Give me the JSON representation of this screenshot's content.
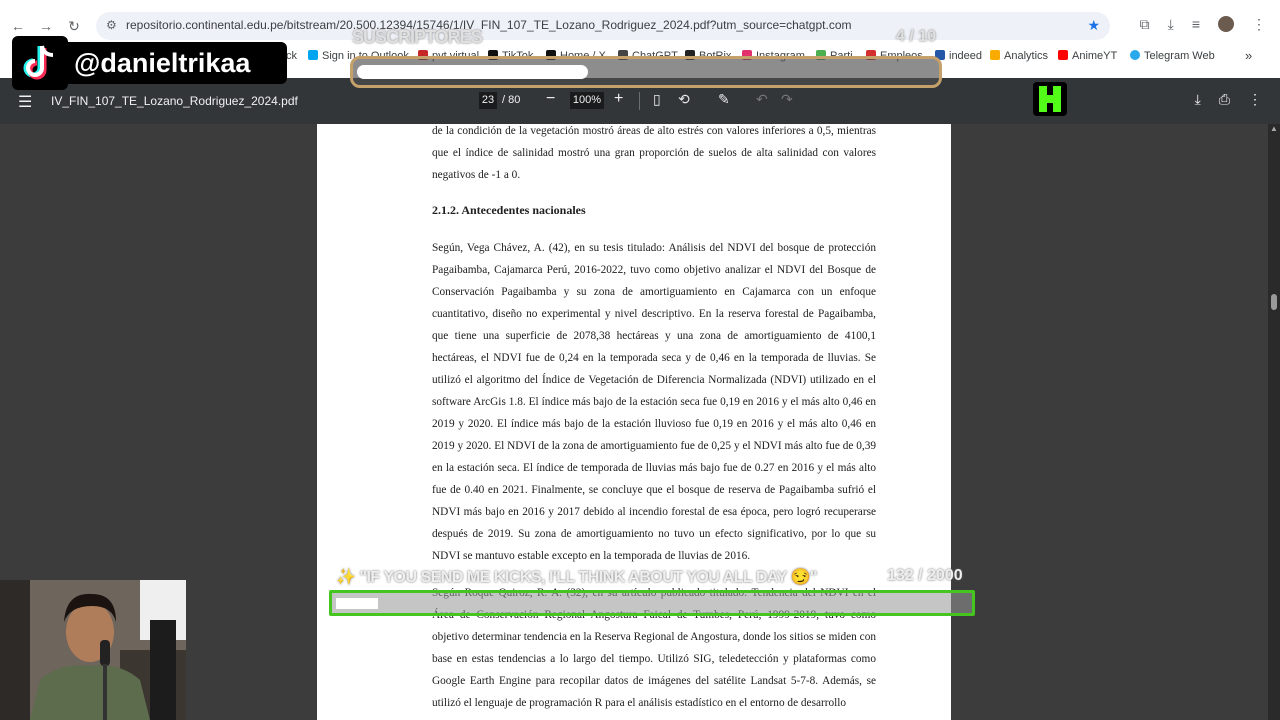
{
  "browser": {
    "url": "repositorio.continental.edu.pe/bitstream/20.500.12394/15746/1/IV_FIN_107_TE_Lozano_Rodriguez_2024.pdf?utm_source=chatgpt.com",
    "bookmarks": [
      "ck",
      "Sign in to Outlook",
      "pvt virtual",
      "TikTok",
      "Home / X",
      "ChatGPT",
      "BotRix",
      "Instagram",
      "Parti",
      "Empleos",
      "indeed",
      "Analytics",
      "AnimeYT",
      "Telegram Web"
    ]
  },
  "pdf": {
    "filename": "IV_FIN_107_TE_Lozano_Rodriguez_2024.pdf",
    "page_current": "23",
    "page_total": "/ 80",
    "zoom": "100%",
    "paragraph_intro": "de la condición de la vegetación mostró áreas de alto estrés con valores inferiores a 0,5, mientras que el índice de salinidad mostró una gran proporción de suelos de alta salinidad con valores negativos de -1 a 0.",
    "heading": "2.1.2.  Antecedentes nacionales",
    "paragraph_1": "Según, Vega Chávez, A. (42), en su tesis titulado: Análisis del NDVI del bosque de protección Pagaibamba, Cajamarca Perú, 2016-2022, tuvo como objetivo analizar el NDVI del Bosque de Conservación Pagaibamba y su zona de amortiguamiento en Cajamarca con un enfoque cuantitativo, diseño no experimental y nivel descriptivo. En la reserva forestal de Pagaibamba, que tiene una superficie de 2078,38 hectáreas y una zona de amortiguamiento de 4100,1 hectáreas, el NDVI fue de 0,24 en la temporada seca y de 0,46 en la temporada de lluvias. Se utilizó el algoritmo del Índice de Vegetación de Diferencia Normalizada (NDVI) utilizado en el software ArcGis 1.8. El índice más bajo de la estación seca fue 0,19 en 2016 y el más alto 0,46 en 2019 y 2020. El índice más bajo de la estación lluvioso fue 0,19 en 2016 y el más alto 0,46 en 2019 y 2020. El NDVI de la zona de amortiguamiento fue de 0,25 y el NDVI más alto fue de 0,39 en la estación seca. El índice de temporada de lluvias más bajo fue de 0.27 en 2016 y el más alto fue de 0.40 en 2021. Finalmente, se concluye que el bosque de reserva de Pagaibamba sufrió el NDVI más bajo en 2016 y 2017 debido al incendio forestal de esa época, pero logró recuperarse después de 2019. Su zona de amortiguamiento no tuvo un efecto significativo, por lo que su NDVI se mantuvo estable excepto en la temporada de lluvias de 2016.",
    "paragraph_2": "Según Roque Quiroz, R. A. (32), en su artículo publicado titulado: Tendencia del NDVI en el Área de Conservación Regional Angostura Faical de Tumbes, Perú, 1999-2019, tuvo como objetivo determinar tendencia en la Reserva Regional de Angostura, donde los sitios se miden con base en estas tendencias a lo largo del tiempo. Utilizó SIG, teledetección y plataformas como Google Earth Engine para recopilar datos de imágenes del satélite Landsat 5-7-8. Además, se utilizó el lenguaje de programación R para el análisis estadístico en el entorno de desarrollo"
  },
  "overlay": {
    "handle": "@danieltrikaa",
    "subs_label": "SUSCRIPTORES",
    "subs_count": "4  / 10",
    "subs_progress": 0.4,
    "kicks_label": "✨ \"IF YOU SEND ME KICKS, I'LL THINK ABOUT YOU ALL DAY 😏\"",
    "kicks_count": "132  / 2000",
    "kicks_progress": 0.066
  },
  "colors": {
    "pdf_toolbar": "#323639",
    "viewer_bg": "#3c3c3c",
    "subs_border": "#c4a06a",
    "kicks_border": "#45c51f",
    "kick_green": "#53fc18"
  }
}
